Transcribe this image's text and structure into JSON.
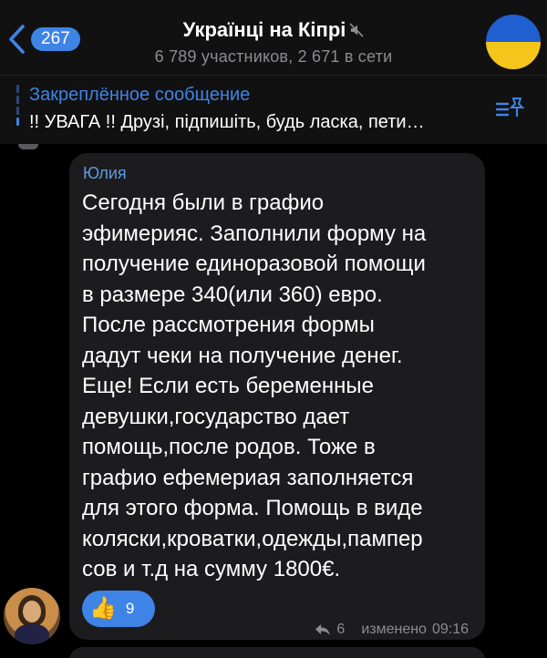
{
  "header": {
    "back_badge": "267",
    "title": "Українці на Кіпрі",
    "subtitle": "6 789 участников, 2 671 в сети",
    "flag_colors": [
      "#1f5fcf",
      "#f4c51a"
    ]
  },
  "pinned": {
    "title": "Закреплённое сообщение",
    "text": "!! УВАГА !! Друзі, підпишіть, будь ласка, пети…",
    "icon": "pinned-list-icon"
  },
  "message": {
    "sender": "Юлия",
    "lines": [
      "Сегодня были в графио",
      "эфимерияс. Заполнили форму на",
      "получение единоразовой помощи",
      "в размере 340(или 360) евро.",
      "После рассмотрения формы",
      "дадут чеки на получение денег.",
      "Еще! Если есть беременные",
      "девушки,государство дает",
      "помощь,после родов. Тоже в",
      "графио ефемериая заполняется",
      "для этого форма. Помощь в виде",
      "коляски,кроватки,одежды,пампер",
      "сов и т.д на сумму 1800€."
    ],
    "reaction": {
      "emoji": "👍",
      "count": "9"
    },
    "replies": "6",
    "edited_label": "изменено",
    "time": "09:16"
  },
  "colors": {
    "accent": "#3e84e6",
    "sender_name": "#5d9be3",
    "bubble": "#1c1c1e",
    "header_bg": "#111112",
    "muted_text": "#8c8c90"
  }
}
